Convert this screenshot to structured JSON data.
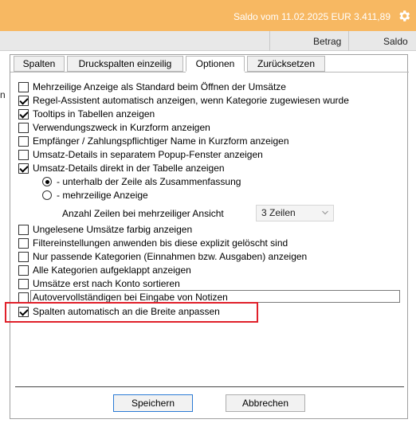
{
  "topbar": {
    "saldo_text": "Saldo vom 11.02.2025 EUR 3.411,89",
    "settings_icon": "gear-icon"
  },
  "columns": {
    "betrag": "Betrag",
    "saldo": "Saldo"
  },
  "left_partial": "n",
  "tabs": [
    {
      "label": "Spalten",
      "active": false
    },
    {
      "label": "Druckspalten einzeilig",
      "active": false
    },
    {
      "label": "Optionen",
      "active": true
    },
    {
      "label": "Zurücksetzen",
      "active": false
    }
  ],
  "options": [
    {
      "label": "Mehrzeilige Anzeige als Standard beim Öffnen der Umsätze",
      "checked": false
    },
    {
      "label": "Regel-Assistent automatisch anzeigen, wenn Kategorie zugewiesen wurde",
      "checked": true
    },
    {
      "label": "Tooltips in Tabellen anzeigen",
      "checked": true
    },
    {
      "label": "Verwendungszweck in Kurzform anzeigen",
      "checked": false
    },
    {
      "label": "Empfänger / Zahlungspflichtiger Name in Kurzform anzeigen",
      "checked": false
    },
    {
      "label": "Umsatz-Details in separatem Popup-Fenster anzeigen",
      "checked": false
    },
    {
      "label": "Umsatz-Details direkt in der Tabelle anzeigen",
      "checked": true
    }
  ],
  "radios": [
    {
      "label": "- unterhalb der Zeile als Zusammenfassung",
      "selected": true
    },
    {
      "label": "- mehrzeilige Anzeige",
      "selected": false
    }
  ],
  "lines_setting": {
    "label": "Anzahl Zeilen bei mehrzeiliger Ansicht",
    "value": "3 Zeilen"
  },
  "options2": [
    {
      "label": "Ungelesene Umsätze farbig anzeigen",
      "checked": false
    },
    {
      "label": "Filtereinstellungen anwenden bis diese explizit gelöscht sind",
      "checked": false
    },
    {
      "label": "Nur passende Kategorien (Einnahmen bzw. Ausgaben) anzeigen",
      "checked": false
    },
    {
      "label": "Alle Kategorien aufgeklappt anzeigen",
      "checked": false
    },
    {
      "label": "Umsätze erst nach Konto sortieren",
      "checked": false
    },
    {
      "label": "Autovervollständigen bei Eingabe von Notizen",
      "checked": false
    },
    {
      "label": "Spalten automatisch an die Breite anpassen",
      "checked": true
    }
  ],
  "buttons": {
    "save": "Speichern",
    "cancel": "Abbrechen"
  },
  "colors": {
    "topbar": "#f7b862",
    "highlight": "#e0202a",
    "primary_border": "#2a7ad5"
  }
}
